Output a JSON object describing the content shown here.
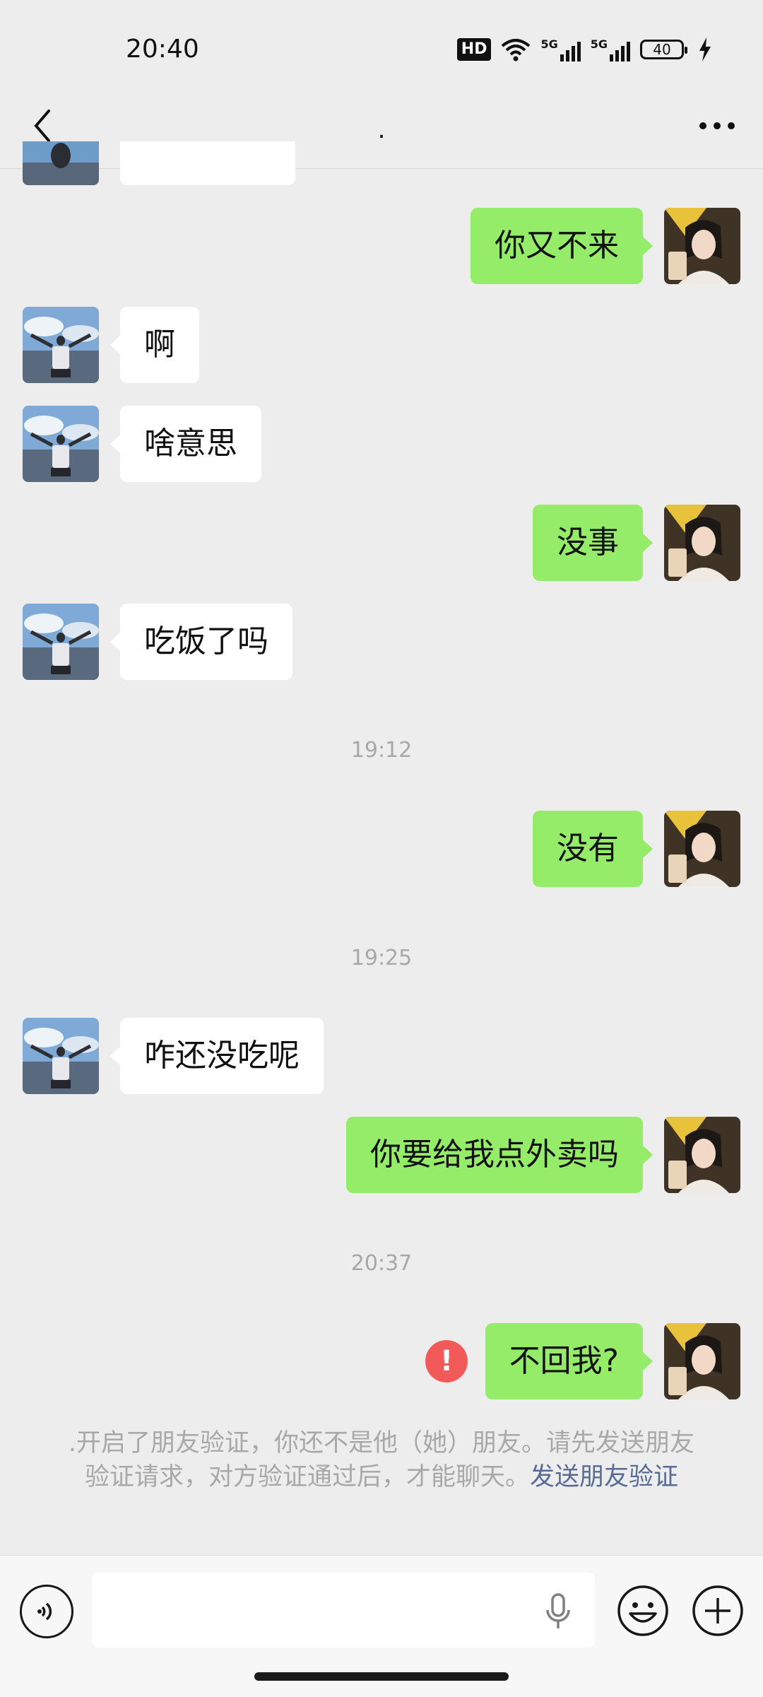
{
  "status_bar": {
    "time": "20:40",
    "hd_label": "HD",
    "network_1": "5G",
    "network_2": "5G",
    "battery": "40",
    "icons": [
      "hd-voice-icon",
      "wifi-icon",
      "signal-5g-icon",
      "signal-5g-icon",
      "battery-icon",
      "charging-icon"
    ]
  },
  "nav": {
    "title": ".",
    "back_icon": "chevron-left-icon",
    "more_icon": "more-dots-icon"
  },
  "messages": [
    {
      "side": "right",
      "text": "你又不来"
    },
    {
      "side": "left",
      "text": "啊"
    },
    {
      "side": "left",
      "text": "啥意思"
    },
    {
      "side": "right",
      "text": "没事"
    },
    {
      "side": "left",
      "text": "吃饭了吗"
    },
    {
      "type": "time",
      "text": "19:12"
    },
    {
      "side": "right",
      "text": "没有"
    },
    {
      "type": "time",
      "text": "19:25"
    },
    {
      "side": "left",
      "text": "咋还没吃呢"
    },
    {
      "side": "right",
      "text": "你要给我点外卖吗"
    },
    {
      "type": "time",
      "text": "20:37"
    },
    {
      "side": "right",
      "text": "不回我?",
      "failed": true
    }
  ],
  "system_notice": {
    "text": ".开启了朋友验证，你还不是他（她）朋友。请先发送朋友验证请求，对方验证通过后，才能聊天。",
    "link": "发送朋友验证"
  },
  "input_bar": {
    "value": "",
    "icons": [
      "voice-icon",
      "microphone-icon",
      "emoji-icon",
      "plus-icon"
    ]
  },
  "colors": {
    "background": "#EDEDED",
    "sent_bubble": "#95EC69",
    "received_bubble": "#FFFFFF",
    "link": "#576B95",
    "error": "#F25A5A"
  }
}
